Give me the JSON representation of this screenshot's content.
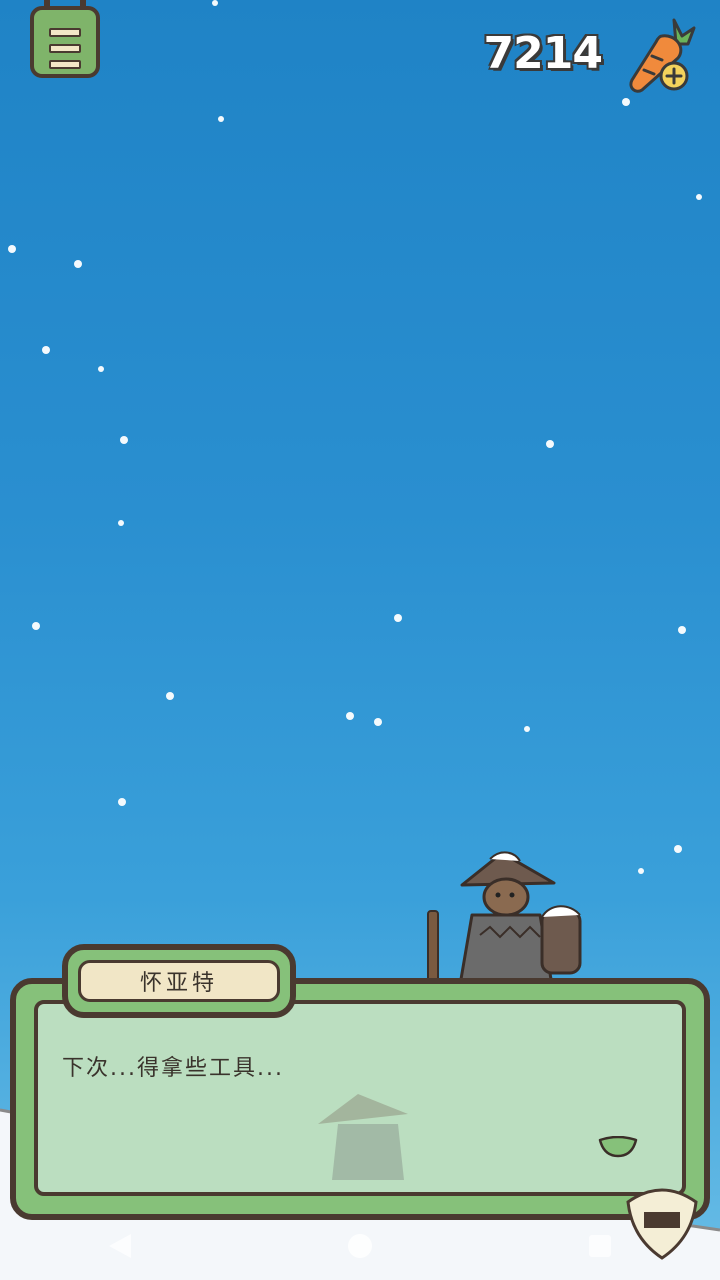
{
  "hud": {
    "menu_icon": "menu-list-icon",
    "carrot_count": "7214",
    "carrot_icon": "carrot-plus-icon"
  },
  "scene": {
    "sky_color": "#2a8fd0",
    "snow_color": "#ffffff",
    "npc_icon": "hooded-traveler-figure"
  },
  "dialog": {
    "speaker_name": "怀亚特",
    "text": "下次...得拿些工具...",
    "continue_icon": "continue-arrow-icon"
  },
  "colors": {
    "panel_green": "#86c17a",
    "outline": "#4a3a30",
    "nameplate": "#f1e6c6"
  },
  "system_nav": {
    "back_icon": "back-triangle-icon",
    "home_icon": "home-circle-icon",
    "recents_icon": "recents-square-icon"
  }
}
